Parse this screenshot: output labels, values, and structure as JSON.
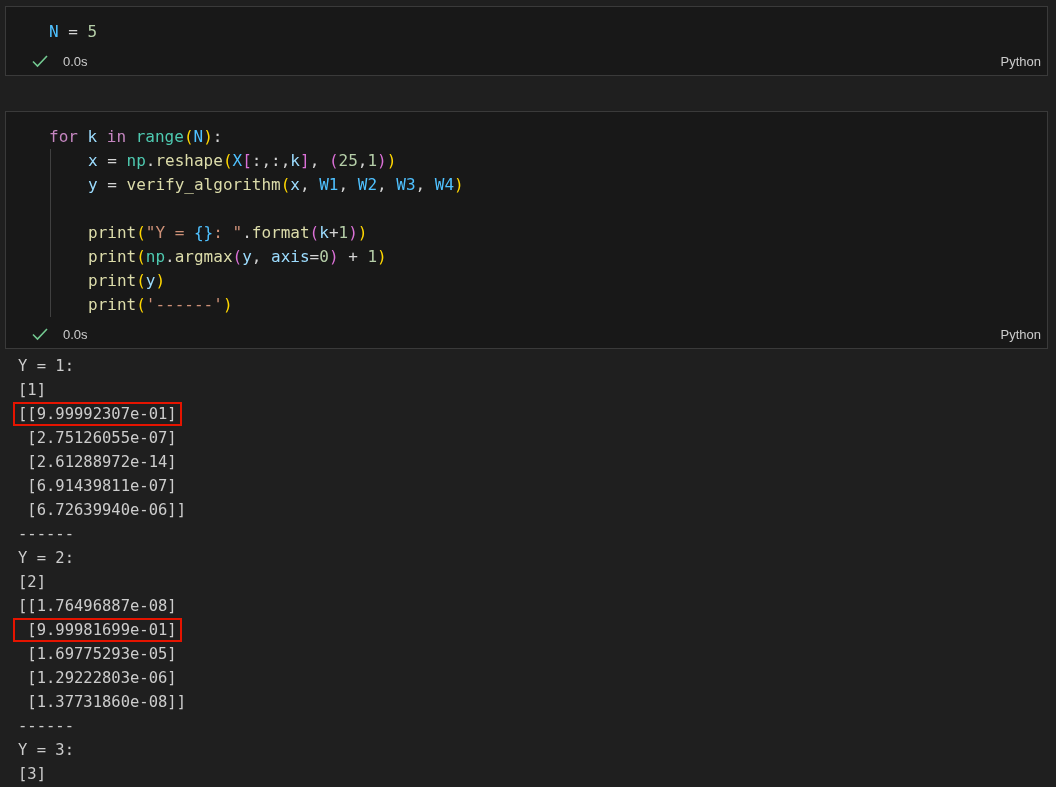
{
  "cells": [
    {
      "code": [
        {
          "indented": false,
          "tokens": [
            {
              "text": "N",
              "kind": "const"
            },
            {
              "text": " = ",
              "kind": "op"
            },
            {
              "text": "5",
              "kind": "num"
            }
          ]
        }
      ],
      "status": {
        "success": true,
        "time": "0.0s"
      },
      "language": "Python"
    },
    {
      "code": [
        {
          "indented": false,
          "tokens": [
            {
              "text": "for ",
              "kind": "kw"
            },
            {
              "text": "k ",
              "kind": "var"
            },
            {
              "text": "in ",
              "kind": "kw"
            },
            {
              "text": "range",
              "kind": "cls"
            },
            {
              "text": "(",
              "kind": "b1"
            },
            {
              "text": "N",
              "kind": "const"
            },
            {
              "text": ")",
              "kind": "b1"
            },
            {
              "text": ":",
              "kind": "op"
            }
          ]
        },
        {
          "indented": true,
          "tokens": [
            {
              "text": "x",
              "kind": "var"
            },
            {
              "text": " = ",
              "kind": "op"
            },
            {
              "text": "np",
              "kind": "cls"
            },
            {
              "text": ".",
              "kind": "op"
            },
            {
              "text": "reshape",
              "kind": "fn"
            },
            {
              "text": "(",
              "kind": "b1"
            },
            {
              "text": "X",
              "kind": "const"
            },
            {
              "text": "[",
              "kind": "b2"
            },
            {
              "text": ":,:,",
              "kind": "op"
            },
            {
              "text": "k",
              "kind": "var"
            },
            {
              "text": "]",
              "kind": "b2"
            },
            {
              "text": ", ",
              "kind": "op"
            },
            {
              "text": "(",
              "kind": "b2"
            },
            {
              "text": "25",
              "kind": "num"
            },
            {
              "text": ",",
              "kind": "op"
            },
            {
              "text": "1",
              "kind": "num"
            },
            {
              "text": ")",
              "kind": "b2"
            },
            {
              "text": ")",
              "kind": "b1"
            }
          ]
        },
        {
          "indented": true,
          "tokens": [
            {
              "text": "y",
              "kind": "var"
            },
            {
              "text": " = ",
              "kind": "op"
            },
            {
              "text": "verify_algorithm",
              "kind": "fn"
            },
            {
              "text": "(",
              "kind": "b1"
            },
            {
              "text": "x",
              "kind": "var"
            },
            {
              "text": ", ",
              "kind": "op"
            },
            {
              "text": "W1",
              "kind": "const"
            },
            {
              "text": ", ",
              "kind": "op"
            },
            {
              "text": "W2",
              "kind": "const"
            },
            {
              "text": ", ",
              "kind": "op"
            },
            {
              "text": "W3",
              "kind": "const"
            },
            {
              "text": ", ",
              "kind": "op"
            },
            {
              "text": "W4",
              "kind": "const"
            },
            {
              "text": ")",
              "kind": "b1"
            }
          ]
        },
        {
          "indented": true
        },
        {
          "indented": true,
          "tokens": [
            {
              "text": "print",
              "kind": "fn"
            },
            {
              "text": "(",
              "kind": "b1"
            },
            {
              "text": "\"Y = ",
              "kind": "str"
            },
            {
              "text": "{}",
              "kind": "const"
            },
            {
              "text": ": \"",
              "kind": "str"
            },
            {
              "text": ".",
              "kind": "op"
            },
            {
              "text": "format",
              "kind": "fn"
            },
            {
              "text": "(",
              "kind": "b2"
            },
            {
              "text": "k",
              "kind": "var"
            },
            {
              "text": "+",
              "kind": "op"
            },
            {
              "text": "1",
              "kind": "num"
            },
            {
              "text": ")",
              "kind": "b2"
            },
            {
              "text": ")",
              "kind": "b1"
            }
          ]
        },
        {
          "indented": true,
          "tokens": [
            {
              "text": "print",
              "kind": "fn"
            },
            {
              "text": "(",
              "kind": "b1"
            },
            {
              "text": "np",
              "kind": "cls"
            },
            {
              "text": ".",
              "kind": "op"
            },
            {
              "text": "argmax",
              "kind": "fn"
            },
            {
              "text": "(",
              "kind": "b2"
            },
            {
              "text": "y",
              "kind": "var"
            },
            {
              "text": ", ",
              "kind": "op"
            },
            {
              "text": "axis",
              "kind": "var"
            },
            {
              "text": "=",
              "kind": "op"
            },
            {
              "text": "0",
              "kind": "num"
            },
            {
              "text": ")",
              "kind": "b2"
            },
            {
              "text": " + ",
              "kind": "op"
            },
            {
              "text": "1",
              "kind": "num"
            },
            {
              "text": ")",
              "kind": "b1"
            }
          ]
        },
        {
          "indented": true,
          "tokens": [
            {
              "text": "print",
              "kind": "fn"
            },
            {
              "text": "(",
              "kind": "b1"
            },
            {
              "text": "y",
              "kind": "var"
            },
            {
              "text": ")",
              "kind": "b1"
            }
          ]
        },
        {
          "indented": true,
          "tokens": [
            {
              "text": "print",
              "kind": "fn"
            },
            {
              "text": "(",
              "kind": "b1"
            },
            {
              "text": "'------'",
              "kind": "str"
            },
            {
              "text": ")",
              "kind": "b1"
            }
          ]
        }
      ],
      "status": {
        "success": true,
        "time": "0.0s"
      },
      "language": "Python",
      "output": [
        {
          "text": "Y = 1:",
          "highlighted": false
        },
        {
          "text": "[1]",
          "highlighted": false
        },
        {
          "text": "[[9.99992307e-01]",
          "highlighted": true
        },
        {
          "text": " [2.75126055e-07]",
          "highlighted": false
        },
        {
          "text": " [2.61288972e-14]",
          "highlighted": false
        },
        {
          "text": " [6.91439811e-07]",
          "highlighted": false
        },
        {
          "text": " [6.72639940e-06]]",
          "highlighted": false
        },
        {
          "text": "------",
          "highlighted": false
        },
        {
          "text": "Y = 2:",
          "highlighted": false
        },
        {
          "text": "[2]",
          "highlighted": false
        },
        {
          "text": "[[1.76496887e-08]",
          "highlighted": false
        },
        {
          "text": " [9.99981699e-01]",
          "highlighted": true
        },
        {
          "text": " [1.69775293e-05]",
          "highlighted": false
        },
        {
          "text": " [1.29222803e-06]",
          "highlighted": false
        },
        {
          "text": " [1.37731860e-08]]",
          "highlighted": false
        },
        {
          "text": "------",
          "highlighted": false
        },
        {
          "text": "Y = 3:",
          "highlighted": false
        },
        {
          "text": "[3]",
          "highlighted": false
        }
      ]
    }
  ]
}
